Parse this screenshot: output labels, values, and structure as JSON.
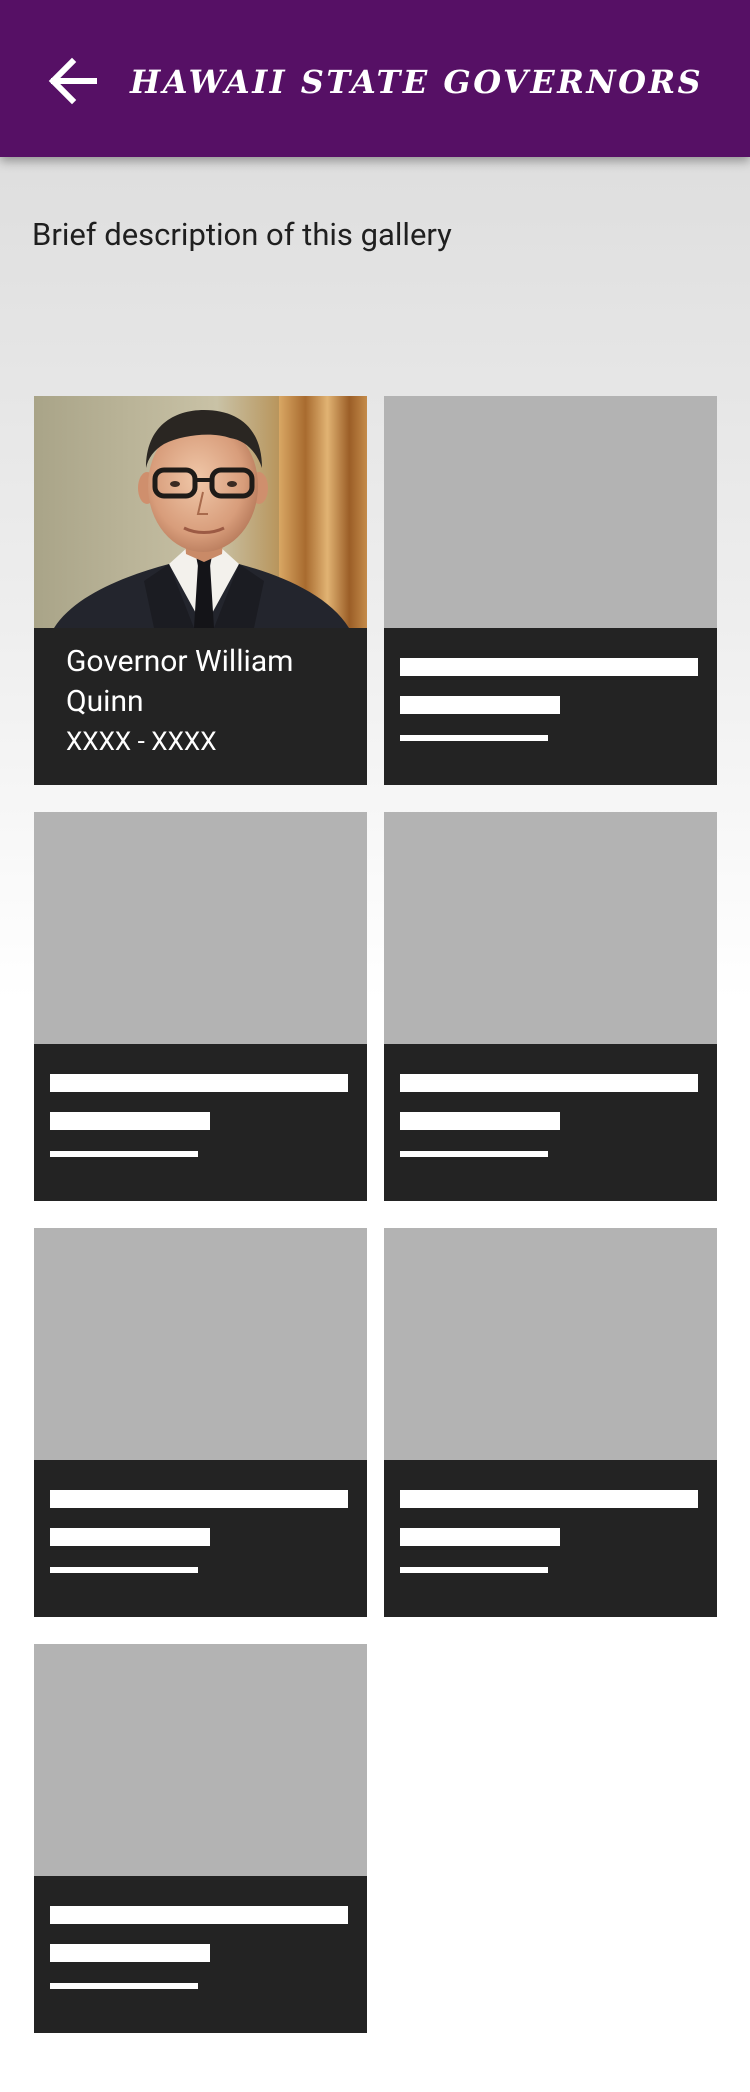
{
  "header": {
    "title": "HAWAII STATE GOVERNORS",
    "back_icon": "arrow-left-icon",
    "background_color": "#561065"
  },
  "description": "Brief description of this gallery",
  "gallery": {
    "items": [
      {
        "name": "Governor William Quinn",
        "years": "XXXX - XXXX",
        "image": "portrait"
      },
      {
        "placeholder": true
      },
      {
        "placeholder": true
      },
      {
        "placeholder": true
      },
      {
        "placeholder": true
      },
      {
        "placeholder": true
      },
      {
        "placeholder": true
      }
    ]
  },
  "colors": {
    "card_caption": "#232323",
    "image_placeholder": "#b3b3b3"
  }
}
